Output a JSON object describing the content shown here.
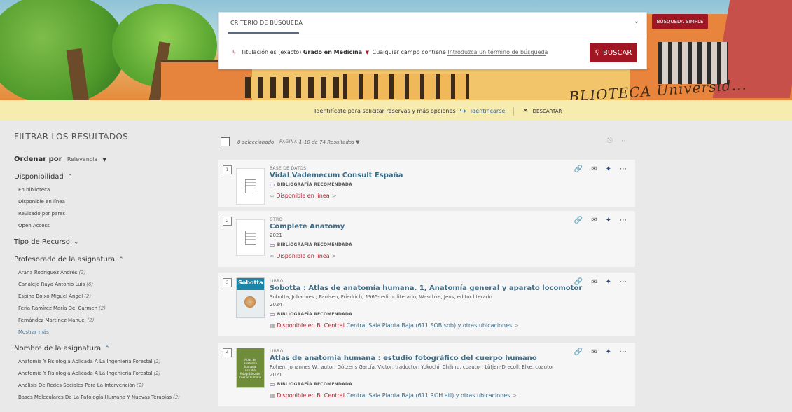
{
  "banner": {
    "signature": "...BLIOTECA Universid..."
  },
  "search": {
    "criterio_label": "CRITERIO DE BÚSQUEDA",
    "query_field": "Titulación",
    "query_op1": "es (exacto)",
    "query_value": "Grado en Medicina",
    "query_field2": "Cualquier campo",
    "query_op2": "contiene",
    "query_placeholder": "Introduzca un término de búsqueda",
    "search_button": "BUSCAR",
    "simple_button": "BÚSQUEDA SIMPLE"
  },
  "notice": {
    "text": "Identifícate para solicitar reservas y más opciones",
    "login": "Identificarse",
    "dismiss": "DESCARTAR"
  },
  "sidebar": {
    "title": "FILTRAR LOS RESULTADOS",
    "sort_label": "Ordenar por",
    "sort_value": "Relevancia",
    "disponibilidad": {
      "label": "Disponibilidad",
      "items": [
        "En biblioteca",
        "Disponible en línea",
        "Revisado por pares",
        "Open Access"
      ]
    },
    "tipo": {
      "label": "Tipo de Recurso"
    },
    "profesorado": {
      "label": "Profesorado de la asignatura",
      "items": [
        {
          "name": "Arana Rodríguez Andrés",
          "count": "(2)"
        },
        {
          "name": "Canalejo Raya Antonio Luis",
          "count": "(6)"
        },
        {
          "name": "Espina Boixo Miguel Ángel",
          "count": "(2)"
        },
        {
          "name": "Feria Ramírez María Del Carmen",
          "count": "(2)"
        },
        {
          "name": "Fernández Martínez Manuel",
          "count": "(2)"
        }
      ],
      "more": "Mostrar más"
    },
    "asignatura": {
      "label": "Nombre de la asignatura",
      "items": [
        {
          "name": "Anatomía Y Fisiología Aplicada A La Ingeniería Forestal",
          "count": "(2)"
        },
        {
          "name": "Anatomía Y Fisiología Aplicada A La Ingeniería Forestal",
          "count": "(2)"
        },
        {
          "name": "Análisis De Redes Sociales Para La Intervención",
          "count": "(2)"
        },
        {
          "name": "Bases Moleculares De La Patología Humana Y Nuevas Terapias",
          "count": "(2)"
        }
      ]
    }
  },
  "results_header": {
    "selected": "0 seleccionado",
    "page": "PÁGINA 1",
    "count": "1-10 de 74 Resultados"
  },
  "results": [
    {
      "num": "1",
      "type": "BASE DE DATOS",
      "title": "Vidal Vademecum Consult España",
      "biblio": "BIBLIOGRAFÍA RECOMENDADA",
      "availability": "Disponible en línea"
    },
    {
      "num": "2",
      "type": "OTRO",
      "title": "Complete Anatomy",
      "year": "2021",
      "biblio": "BIBLIOGRAFÍA RECOMENDADA",
      "availability": "Disponible en línea"
    },
    {
      "num": "3",
      "type": "LIBRO",
      "title": "Sobotta : Atlas de anatomía humana. 1, Anatomía general y aparato locomotor",
      "authors": "Sobotta, Johannes.; Paulsen, Friedrich, 1965- editor literario; Waschke, Jens, editor literario",
      "year": "2024",
      "biblio": "BIBLIOGRAFÍA RECOMENDADA",
      "availability": "Disponible en B. Central",
      "location": "Central Sala Planta Baja (611 SOB sob) y otras ubicaciones",
      "cover_text": "Sobotta"
    },
    {
      "num": "4",
      "type": "LIBRO",
      "title": "Atlas de anatomía humana : estudio fotográfico del cuerpo humano",
      "authors": "Rohen, Johannes W., autor; Götzens García, Víctor, traductor; Yokochi, Chihiro, coautor; Lütjen-Drecoll, Elke, coautor",
      "year": "2021",
      "biblio": "BIBLIOGRAFÍA RECOMENDADA",
      "availability": "Disponible en B. Central",
      "location": "Central Sala Planta Baja (611 ROH atl) y otras ubicaciones",
      "cover_text": "Atlas de anatomía humana. Estudio fotográfico del cuerpo humano"
    }
  ]
}
